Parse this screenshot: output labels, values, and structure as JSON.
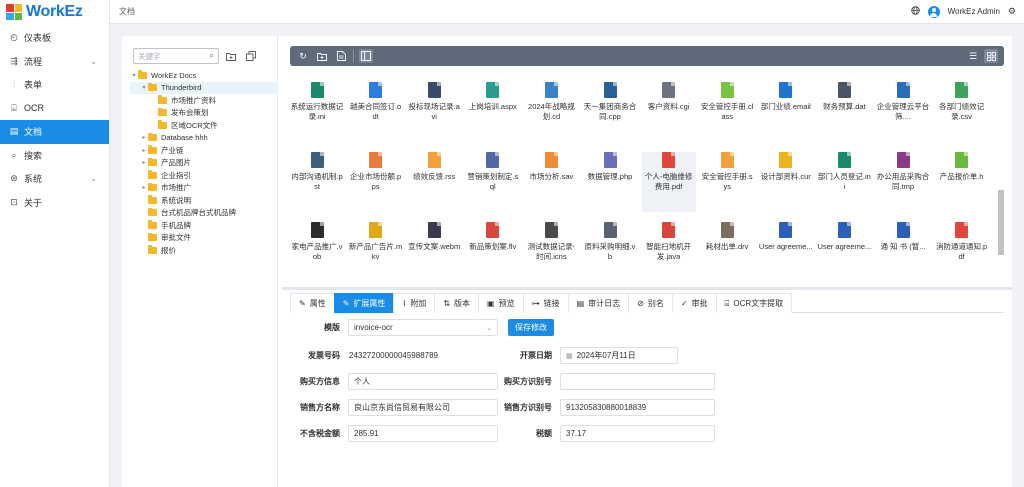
{
  "app": {
    "logo_text": "WorkEz",
    "colors": {
      "accent": "#1a8ce5",
      "folder": "#f5b829"
    }
  },
  "sidebar": {
    "items": [
      {
        "label": "仪表板",
        "icon": "dashboard-icon"
      },
      {
        "label": "流程",
        "icon": "flow-icon",
        "has_chevron": true
      },
      {
        "label": "表单",
        "icon": "form-icon"
      },
      {
        "label": "OCR",
        "icon": "ocr-icon"
      },
      {
        "label": "文档",
        "icon": "document-icon",
        "active": true
      },
      {
        "label": "搜索",
        "icon": "search-icon"
      },
      {
        "label": "系统",
        "icon": "system-icon",
        "has_chevron": true
      },
      {
        "label": "关于",
        "icon": "about-icon"
      }
    ]
  },
  "header": {
    "breadcrumb": "文档",
    "user": "WorkEz Admin"
  },
  "tree": {
    "search_placeholder": "关键字",
    "nodes": [
      {
        "label": "WorkEz Docs",
        "level": 0,
        "expanded": true
      },
      {
        "label": "Thunderbird",
        "level": 1,
        "expanded": true,
        "selected": true
      },
      {
        "label": "市场推广资料",
        "level": 2
      },
      {
        "label": "发布会策划",
        "level": 2
      },
      {
        "label": "区域OCR文件",
        "level": 2
      },
      {
        "label": "Database hhh",
        "level": 1,
        "collapsed": true
      },
      {
        "label": "产业链",
        "level": 1,
        "collapsed": true
      },
      {
        "label": "产品图片",
        "level": 1,
        "collapsed": true
      },
      {
        "label": "企业指引",
        "level": 1
      },
      {
        "label": "市场推广",
        "level": 1,
        "collapsed": true
      },
      {
        "label": "系统说明",
        "level": 1
      },
      {
        "label": "台式机品牌台式机品牌",
        "level": 1
      },
      {
        "label": "手机品牌",
        "level": 1
      },
      {
        "label": "审批文件",
        "level": 1
      },
      {
        "label": "报价",
        "level": 1
      }
    ]
  },
  "files": [
    {
      "name": "系统运行数据记录.ini",
      "color": "#1b8a6b"
    },
    {
      "name": "越美合同签订.odt",
      "color": "#2e7be0"
    },
    {
      "name": "投标现场记录.avi",
      "color": "#3a4a6b"
    },
    {
      "name": "上岗培训.aspx",
      "color": "#2b9c8d"
    },
    {
      "name": "2024年战略规划.cd",
      "color": "#3b82c4"
    },
    {
      "name": "天一集团商务合同.cpp",
      "color": "#2c5f95"
    },
    {
      "name": "客户资料.cgi",
      "color": "#6b7280"
    },
    {
      "name": "安全管控手册.class",
      "color": "#7cc242"
    },
    {
      "name": "部门业绩.email",
      "color": "#1f73d1"
    },
    {
      "name": "财务预算.dat",
      "color": "#4b5563"
    },
    {
      "name": "企业管理云平台筛....",
      "color": "#2a6fb5"
    },
    {
      "name": "各部门绩效记录.csv",
      "color": "#3da35d"
    },
    {
      "name": "内部沟通机制.pst",
      "color": "#3f5e7a"
    },
    {
      "name": "企业市场份额.pps",
      "color": "#e97a3a"
    },
    {
      "name": "绩效反馈.rss",
      "color": "#f59f3a"
    },
    {
      "name": "营销策划制定.sql",
      "color": "#5468a3"
    },
    {
      "name": "市场分析.sav",
      "color": "#ee8c35"
    },
    {
      "name": "数据管理.php",
      "color": "#6b6fb8"
    },
    {
      "name": "个人-电脑维修费用.pdf",
      "color": "#e2453c",
      "highlight": true
    },
    {
      "name": "安全管控手册.sys",
      "color": "#f0a23b"
    },
    {
      "name": "设计部资料.cur",
      "color": "#e9b51c"
    },
    {
      "name": "部门人员登记.ini",
      "color": "#1b8a6b"
    },
    {
      "name": "办公用品采购合同.tmp",
      "color": "#8a3a8a"
    },
    {
      "name": "产品报价单.h",
      "color": "#6ab93e"
    },
    {
      "name": "家电产品推广.vob",
      "color": "#2d2d2d"
    },
    {
      "name": "新产品广告片.mkv",
      "color": "#e0a91a"
    },
    {
      "name": "宣传文案.webm",
      "color": "#3a3a4a"
    },
    {
      "name": "新品策划案.flv",
      "color": "#d9463b"
    },
    {
      "name": "测试数据记录-时间.icns",
      "color": "#4a4a4a"
    },
    {
      "name": "原料采购明细.vb",
      "color": "#5a6270"
    },
    {
      "name": "智能扫地机开发.java",
      "color": "#d9453a"
    },
    {
      "name": "耗材出单.drv",
      "color": "#7b6e5e"
    },
    {
      "name": "User agreeme...",
      "color": "#2b5fb8"
    },
    {
      "name": "User agreeme...",
      "color": "#2b5fb8"
    },
    {
      "name": "通 知 书 (暂...",
      "color": "#2b5fb8"
    },
    {
      "name": "消防通道通知.pdf",
      "color": "#e2453c"
    }
  ],
  "tabs": [
    {
      "label": "属性",
      "icon": "wrench-icon"
    },
    {
      "label": "扩展属性",
      "icon": "wrench-icon",
      "active": true
    },
    {
      "label": "附加",
      "icon": "paperclip-icon"
    },
    {
      "label": "版本",
      "icon": "sort-icon"
    },
    {
      "label": "预览",
      "icon": "preview-icon"
    },
    {
      "label": "链接",
      "icon": "link-icon"
    },
    {
      "label": "审计日志",
      "icon": "log-icon"
    },
    {
      "label": "别名",
      "icon": "alias-icon"
    },
    {
      "label": "审批",
      "icon": "approve-icon"
    },
    {
      "label": "OCR文字提取",
      "icon": "ocr-text-icon"
    }
  ],
  "form": {
    "template_label": "模版",
    "template_value": "invoice-ocr",
    "save_label": "保存修改",
    "invoice_no_label": "发票号码",
    "invoice_no": "24327200000045988789",
    "date_label": "开票日期",
    "date": "2024年07月11日",
    "buyer_label": "购买方信息",
    "buyer": "个人",
    "buyer_id_label": "购买方识别号",
    "buyer_id": "",
    "seller_label": "销售方名称",
    "seller": "良山京东尚信贸易有限公司",
    "seller_id_label": "销售方识别号",
    "seller_id": "913205830880018839",
    "amount_label": "不含税金额",
    "amount": "285.91",
    "tax_label": "税额",
    "tax": "37.17"
  }
}
